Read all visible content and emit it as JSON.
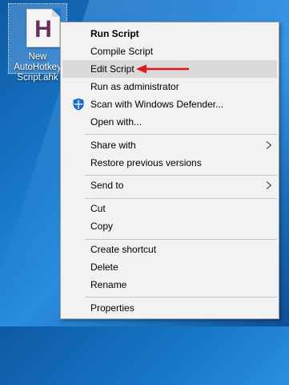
{
  "desktop": {
    "file_icon": {
      "label_lines": [
        "New",
        "AutoHotkey",
        "Script.ahk"
      ],
      "glyph": "H",
      "glyph_color": "#6b2e5a"
    }
  },
  "context_menu": {
    "items": [
      {
        "label": "Run Script"
      },
      {
        "label": "Compile Script"
      },
      {
        "label": "Edit Script"
      },
      {
        "label": "Run as administrator"
      },
      {
        "label": "Scan with Windows Defender..."
      },
      {
        "label": "Open with..."
      },
      {
        "label": "Share with"
      },
      {
        "label": "Restore previous versions"
      },
      {
        "label": "Send to"
      },
      {
        "label": "Cut"
      },
      {
        "label": "Copy"
      },
      {
        "label": "Create shortcut"
      },
      {
        "label": "Delete"
      },
      {
        "label": "Rename"
      },
      {
        "label": "Properties"
      }
    ]
  },
  "annotation": {
    "arrow_color": "#e0181e"
  }
}
